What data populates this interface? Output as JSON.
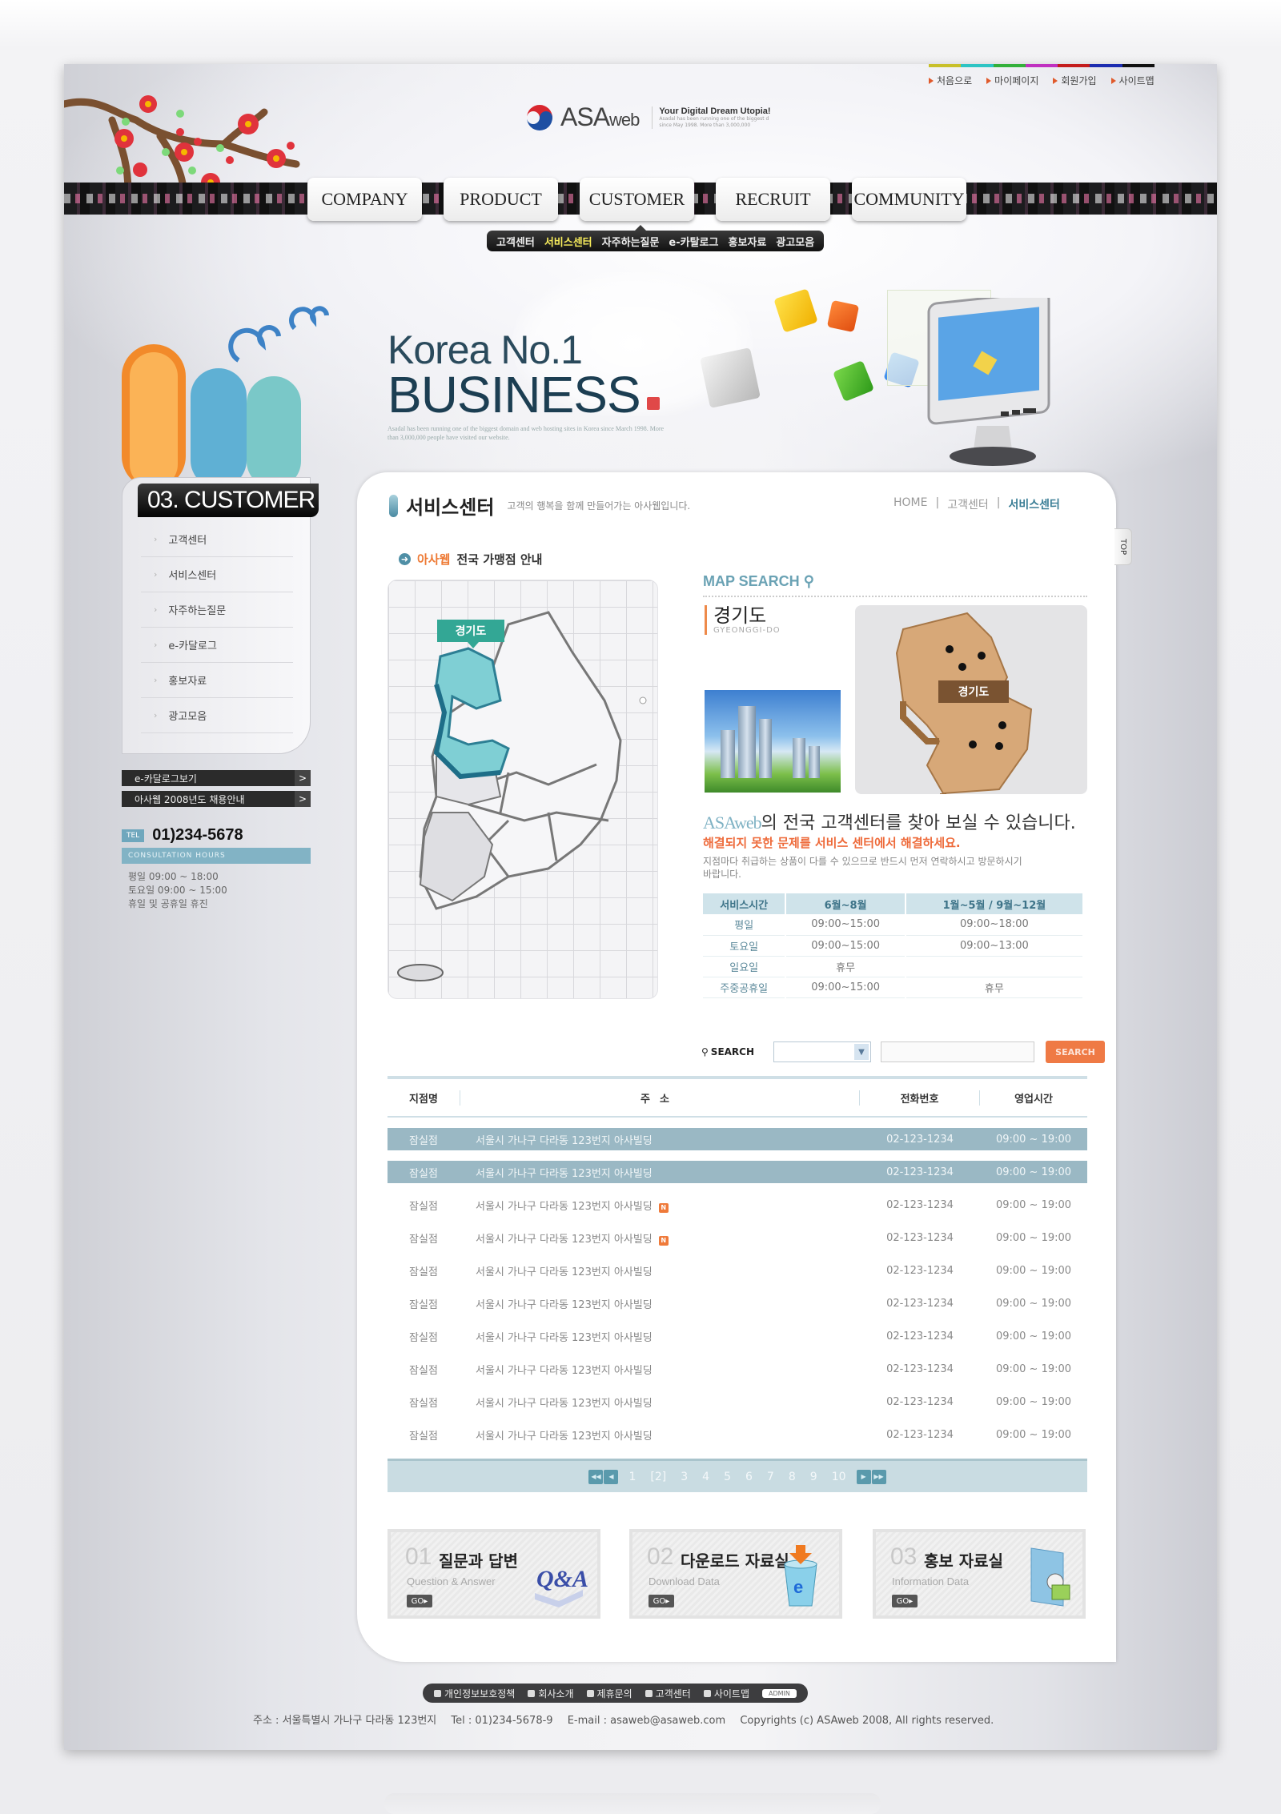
{
  "colors": {
    "accent_teal": "#6fa7bd",
    "accent_orange": "#ef7a45",
    "nav_highlight": "#f7ec5b",
    "rainbow": [
      "#c8c02a",
      "#2ec4c4",
      "#33b03a",
      "#c030c0",
      "#c41c1c",
      "#1c2cb0",
      "#111111"
    ]
  },
  "utility_links": [
    {
      "label": "처음으로"
    },
    {
      "label": "마이페이지"
    },
    {
      "label": "회원가입"
    },
    {
      "label": "사이트맵"
    }
  ],
  "logo": {
    "brand": "ASA",
    "brand_suffix": "web",
    "tagline": "Your Digital Dream Utopia!",
    "tagline_small": "Asadal has been running one of the biggest d since May 1998. More than 3,000,000"
  },
  "nav": {
    "tabs": [
      "COMPANY",
      "PRODUCT",
      "CUSTOMER",
      "RECRUIT",
      "COMMUNITY"
    ],
    "active_tab": "CUSTOMER",
    "sub_items": [
      {
        "label": "고객센터",
        "active": false
      },
      {
        "label": "서비스센터",
        "active": true
      },
      {
        "label": "자주하는질문",
        "active": false
      },
      {
        "label": "e-카탈로그",
        "active": false
      },
      {
        "label": "홍보자료",
        "active": false
      },
      {
        "label": "광고모음",
        "active": false
      }
    ]
  },
  "hero": {
    "line1": "Korea No.1",
    "line2": "BUSINESS",
    "desc": "Asadal has been running one of the biggest domain and web hosting sites in Korea since March 1998. More than 3,000,000 people have visited our website."
  },
  "sidebar": {
    "title": "03. CUSTOMER",
    "items": [
      {
        "label": "고객센터"
      },
      {
        "label": "서비스센터"
      },
      {
        "label": "자주하는질문"
      },
      {
        "label": "e-카달로그"
      },
      {
        "label": "홍보자료"
      },
      {
        "label": "광고모음"
      }
    ],
    "buttons": [
      {
        "label": "e-카달로그보기",
        "arrow": ">"
      },
      {
        "label": "아사웹 2008년도 채용안내",
        "arrow": ">"
      }
    ],
    "tel_label": "TEL",
    "tel_number": "01)234-5678",
    "hours_title": "CONSULTATION HOURS",
    "hours": [
      "평일 09:00 ~ 18:00",
      "토요일 09:00 ~ 15:00",
      "휴일 및 공휴일 휴진"
    ]
  },
  "page": {
    "title": "서비스센터",
    "subtitle": "고객의 행복을 함께 만들어가는 아사웹입니다.",
    "breadcrumb": [
      "HOME",
      "고객센터",
      "서비스센터"
    ],
    "breadcrumb_sep": "|",
    "top_button": "TOP"
  },
  "map": {
    "heading_brand": "아사웹",
    "heading_rest": "전국 가맹점 안내",
    "selected_region_tag": "경기도"
  },
  "map_search": {
    "title": "MAP SEARCH",
    "region_ko": "경기도",
    "region_en": "GYEONGGI-DO",
    "province_tag": "경기도",
    "intro_brand": "ASAweb",
    "intro_rest": "의 전국 고객센터를 찾아 보실 수 있습니다.",
    "intro_sub": "해결되지 못한 문제를 서비스 센터에서 해결하세요.",
    "intro_note": "지점마다 취급하는 상품이 다를 수 있으므로 반드시 먼저 연락하시고 방문하시기 바랍니다."
  },
  "service_hours": {
    "headers": [
      "서비스시간",
      "6월~8월",
      "1월~5월 / 9월~12월"
    ],
    "rows": [
      [
        "평일",
        "09:00~15:00",
        "09:00~18:00"
      ],
      [
        "토요일",
        "09:00~15:00",
        "09:00~13:00"
      ],
      [
        "일요일",
        "휴무",
        ""
      ],
      [
        "주중공휴일",
        "09:00~15:00",
        "휴무"
      ]
    ]
  },
  "search": {
    "label": "SEARCH",
    "select_value": "",
    "input_value": "",
    "button": "SEARCH"
  },
  "branches": {
    "headers": [
      "지점명",
      "주소",
      "전화번호",
      "영업시간"
    ],
    "rows": [
      {
        "name": "잠실점",
        "address": "서울시 가나구 다라동 123번지 아사빌딩",
        "phone": "02-123-1234",
        "hours": "09:00 ~ 19:00",
        "selected": true,
        "new": false
      },
      {
        "name": "잠실점",
        "address": "서울시 가나구 다라동 123번지 아사빌딩",
        "phone": "02-123-1234",
        "hours": "09:00 ~ 19:00",
        "selected": true,
        "new": false
      },
      {
        "name": "잠실점",
        "address": "서울시 가나구 다라동 123번지 아사빌딩",
        "phone": "02-123-1234",
        "hours": "09:00 ~ 19:00",
        "selected": false,
        "new": true
      },
      {
        "name": "잠실점",
        "address": "서울시 가나구 다라동 123번지 아사빌딩",
        "phone": "02-123-1234",
        "hours": "09:00 ~ 19:00",
        "selected": false,
        "new": true
      },
      {
        "name": "잠실점",
        "address": "서울시 가나구 다라동 123번지 아사빌딩",
        "phone": "02-123-1234",
        "hours": "09:00 ~ 19:00",
        "selected": false,
        "new": false
      },
      {
        "name": "잠실점",
        "address": "서울시 가나구 다라동 123번지 아사빌딩",
        "phone": "02-123-1234",
        "hours": "09:00 ~ 19:00",
        "selected": false,
        "new": false
      },
      {
        "name": "잠실점",
        "address": "서울시 가나구 다라동 123번지 아사빌딩",
        "phone": "02-123-1234",
        "hours": "09:00 ~ 19:00",
        "selected": false,
        "new": false
      },
      {
        "name": "잠실점",
        "address": "서울시 가나구 다라동 123번지 아사빌딩",
        "phone": "02-123-1234",
        "hours": "09:00 ~ 19:00",
        "selected": false,
        "new": false
      },
      {
        "name": "잠실점",
        "address": "서울시 가나구 다라동 123번지 아사빌딩",
        "phone": "02-123-1234",
        "hours": "09:00 ~ 19:00",
        "selected": false,
        "new": false
      },
      {
        "name": "잠실점",
        "address": "서울시 가나구 다라동 123번지 아사빌딩",
        "phone": "02-123-1234",
        "hours": "09:00 ~ 19:00",
        "selected": false,
        "new": false
      }
    ],
    "new_badge": "N"
  },
  "pagination": {
    "pages": [
      "1",
      "[2]",
      "3",
      "4",
      "5",
      "6",
      "7",
      "8",
      "9",
      "10"
    ],
    "current": 2,
    "first": "◀◀",
    "prev": "◀",
    "next": "▶",
    "last": "▶▶"
  },
  "features": [
    {
      "num": "01",
      "title": "질문과 답변",
      "subtitle": "Question & Answer",
      "go": "GO",
      "icon": "qa-book-icon"
    },
    {
      "num": "02",
      "title": "다운로드 자료실",
      "subtitle": "Download Data",
      "go": "GO",
      "icon": "download-bin-icon"
    },
    {
      "num": "03",
      "title": "홍보 자료실",
      "subtitle": "Information Data",
      "go": "GO",
      "icon": "media-folder-icon"
    }
  ],
  "footer": {
    "links": [
      "개인정보보호정책",
      "회사소개",
      "제휴문의",
      "고객센터",
      "사이트맵"
    ],
    "admin": "ADMIN",
    "address": "주소 : 서울특별시 가나구 다라동 123번지",
    "tel": "Tel : 01)234-5678-9",
    "email": "E-mail : asaweb@asaweb.com",
    "copyright": "Copyrights (c) ASAweb 2008, All rights reserved."
  }
}
